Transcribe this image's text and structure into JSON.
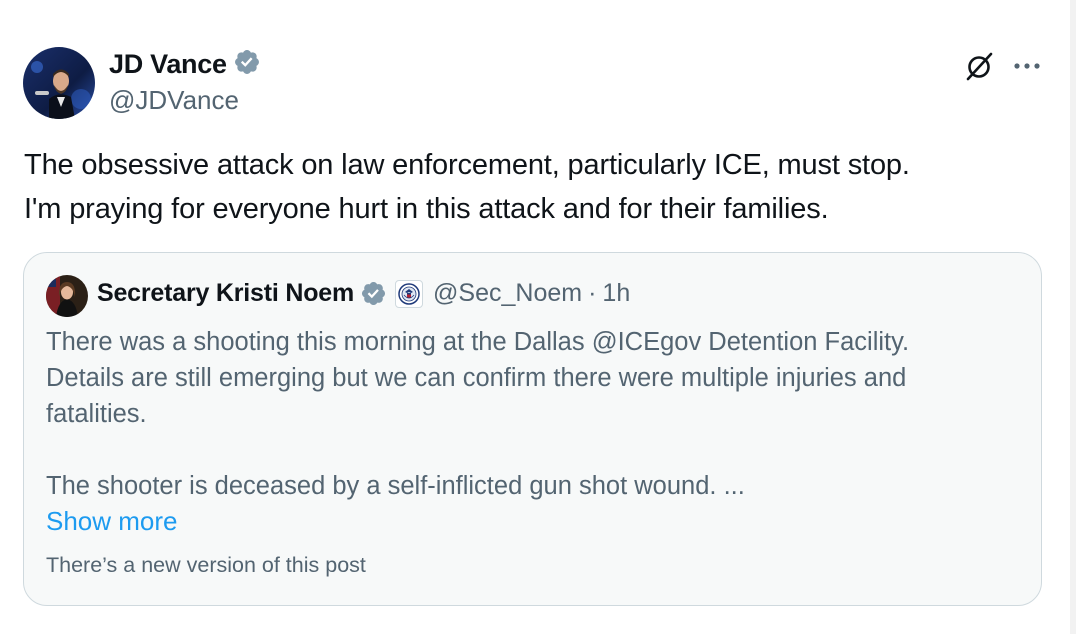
{
  "post": {
    "author": {
      "name": "JD Vance",
      "handle": "@JDVance",
      "verified": true
    },
    "text_lines": [
      "The obsessive attack on law enforcement, particularly ICE, must stop.",
      "I'm praying for everyone hurt in this attack and for their families."
    ],
    "icons": {
      "grok": "grok-icon",
      "more": "more-icon",
      "verified": "verified-badge-icon"
    }
  },
  "quote": {
    "author": {
      "name": "Secretary Kristi Noem",
      "handle": "@Sec_Noem",
      "separator": "·",
      "time": "1h",
      "verified": true,
      "affiliation_icon": "dhs-seal-icon"
    },
    "body_lines": [
      "There was a shooting this morning at the Dallas @ICEgov Detention Facility.",
      "Details are still emerging but we can confirm there were multiple injuries and",
      "fatalities.",
      "The shooter is deceased by a self-inflicted gun shot wound. ..."
    ],
    "show_more": "Show more",
    "new_version_notice": "There’s a new version of this post"
  },
  "colors": {
    "text_primary": "#0f1419",
    "text_secondary": "#536471",
    "link": "#1d9bf0",
    "verified": "#829aab",
    "card_bg": "#f7f9f9",
    "card_border": "#cfd9de"
  }
}
